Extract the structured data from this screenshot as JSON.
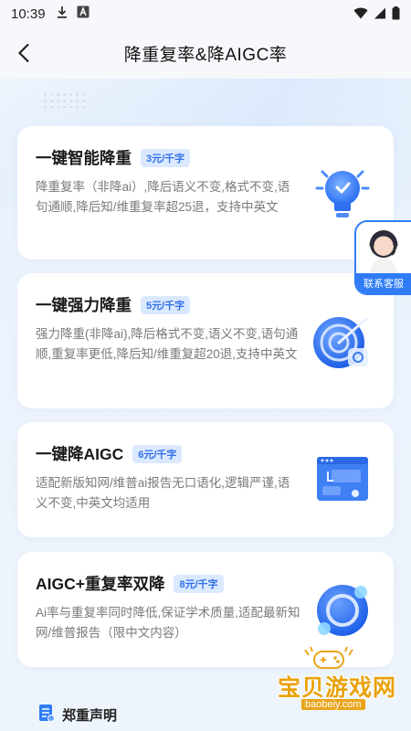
{
  "status": {
    "time": "10:39"
  },
  "nav": {
    "title": "降重复率&降AIGC率"
  },
  "cards": [
    {
      "title": "一键智能降重",
      "price": "3元/千字",
      "desc": "降重复率（非降ai）,降后语义不变,格式不变,语句通顺,降后知/维重复率超25退，支持中英文",
      "icon": "lightbulb-icon"
    },
    {
      "title": "一键强力降重",
      "price": "5元/千字",
      "desc": "强力降重(非降ai),降后格式不变,语义不变,语句通顺,重复率更低,降后知/维重复超20退,支持中英文",
      "icon": "target-icon"
    },
    {
      "title": "一键降AIGC",
      "price": "6元/千字",
      "desc": "适配新版知网/维普ai报告无口语化,逻辑严谨,语义不变,中英文均适用",
      "icon": "browser-window-icon"
    },
    {
      "title": "AIGC+重复率双降",
      "price": "8元/千字",
      "desc": "Ai率与重复率同时降低,保证学术质量,适配最新知网/维普报告（限中文内容）",
      "icon": "ring-icon"
    }
  ],
  "customer_service": {
    "label": "联系客服"
  },
  "declaration": {
    "label": "郑重声明"
  },
  "watermark": {
    "text": "宝贝游戏网",
    "url": "baobeiy.com"
  },
  "colors": {
    "accent": "#2f7cf6",
    "badge_bg": "#dbe9ff",
    "badge_text": "#2f6fe8"
  }
}
